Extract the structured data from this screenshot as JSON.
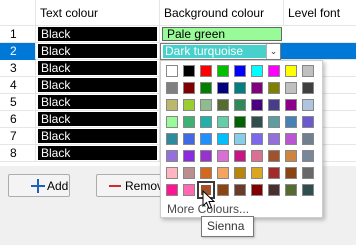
{
  "grid": {
    "columns": [
      "Text colour",
      "Background colour",
      "Level font"
    ],
    "rows": [
      {
        "num": "1",
        "text_colour": "Black",
        "background": "Pale green"
      },
      {
        "num": "2",
        "text_colour": "Black",
        "background": "Dark turquoise"
      },
      {
        "num": "3",
        "text_colour": "Black",
        "background": ""
      },
      {
        "num": "4",
        "text_colour": "Black",
        "background": ""
      },
      {
        "num": "5",
        "text_colour": "Black",
        "background": ""
      },
      {
        "num": "6",
        "text_colour": "Black",
        "background": ""
      },
      {
        "num": "7",
        "text_colour": "Black",
        "background": ""
      },
      {
        "num": "8",
        "text_colour": "Black",
        "background": ""
      }
    ]
  },
  "palette": {
    "colors": [
      [
        "#ffffff",
        "#000000",
        "#ff0000",
        "#00c000",
        "#0000ff",
        "#00ffff",
        "#ff00ff",
        "#ffff00",
        "#c0c0c0"
      ],
      [
        "#808080",
        "#800000",
        "#008000",
        "#000080",
        "#008080",
        "#800080",
        "#808000",
        "#c0c0c0",
        "#404040"
      ],
      [
        "#bdb76b",
        "#9acd32",
        "#8fbc8f",
        "#556b2f",
        "#2e8b57",
        "#4b0082",
        "#483d8b",
        "#8b008b",
        "#b0c4de"
      ],
      [
        "#98fb98",
        "#3cb371",
        "#20b2aa",
        "#66cdaa",
        "#006400",
        "#2f4f4f",
        "#5f9ea0",
        "#4682b4",
        "#6a5acd"
      ],
      [
        "#2e8b9e",
        "#4169e1",
        "#1e90ff",
        "#00bfff",
        "#87ceeb",
        "#7b68ee",
        "#9370db",
        "#ba55d3",
        "#708090"
      ],
      [
        "#9370db",
        "#8a2be2",
        "#9932cc",
        "#da70d6",
        "#c71585",
        "#db7093",
        "#a0522d",
        "#cd853f",
        "#778899"
      ],
      [
        "#ffb6c1",
        "#bc8f8f",
        "#d2691e",
        "#f4a460",
        "#b8860b",
        "#daa520",
        "#a52a2a",
        "#8b4513",
        "#696969"
      ],
      [
        "#ff1493",
        "#ff69b4",
        "#a0522d",
        "#8b4513",
        "#6b3a2a",
        "#800000",
        "#4b2e2e",
        "#556b2f",
        "#2f4f4f"
      ]
    ],
    "selected_label": "Sienna",
    "more_colours_label": "More Colours..."
  },
  "buttons": {
    "add": "Add",
    "remove": "Remove"
  },
  "tooltip": "Sienna"
}
